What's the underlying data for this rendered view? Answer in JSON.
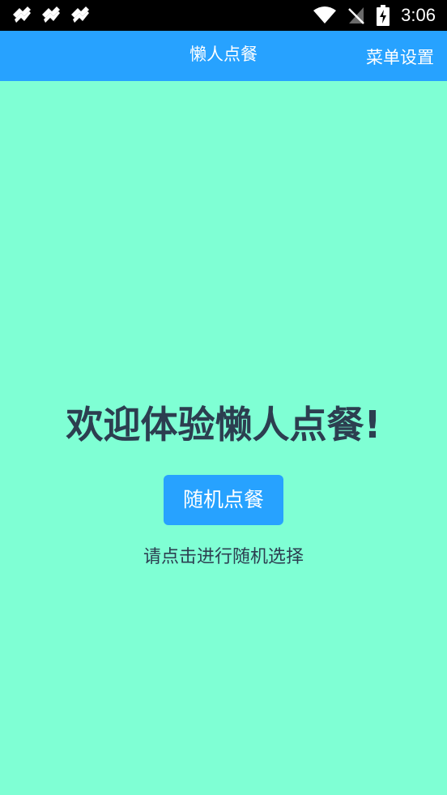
{
  "status_bar": {
    "time": "3:06",
    "icons": [
      "notification-icon",
      "notification-icon",
      "notification-icon",
      "wifi-icon",
      "no-signal-icon",
      "battery-charging-icon"
    ]
  },
  "app_bar": {
    "title": "懒人点餐",
    "menu_settings_label": "菜单设置",
    "color": "#27a2ff"
  },
  "main": {
    "background": "#7fffd4",
    "welcome_text": "欢迎体验懒人点餐!",
    "random_button_label": "随机点餐",
    "hint_text": "请点击进行随机选择"
  }
}
